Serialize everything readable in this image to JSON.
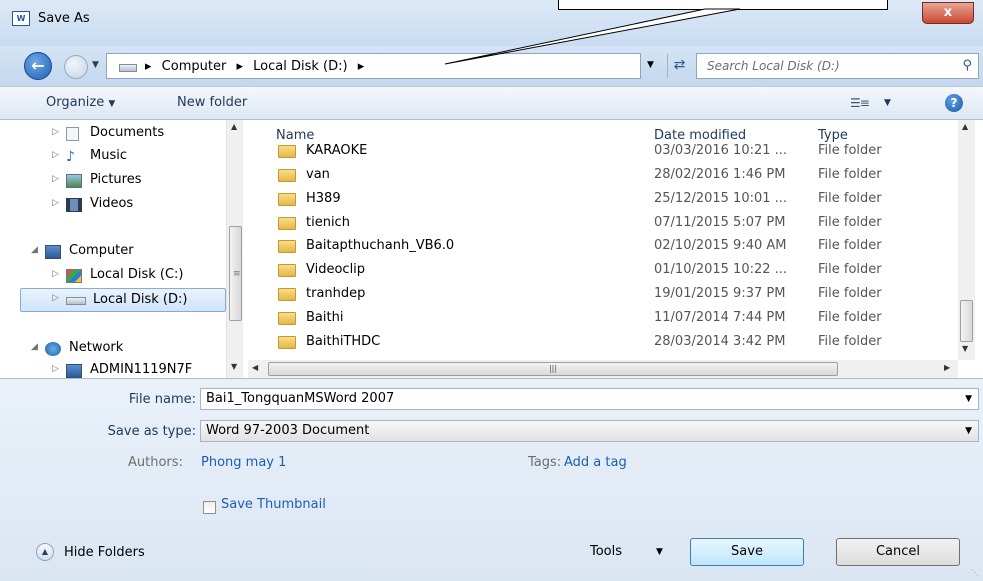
{
  "window": {
    "title": "Save As",
    "close_label": "x",
    "app_icon": "word-icon"
  },
  "address": {
    "breadcrumbs": [
      "Computer",
      "Local Disk (D:)"
    ],
    "search_placeholder": "Search Local Disk (D:)"
  },
  "toolbar": {
    "organize_label": "Organize",
    "new_folder_label": "New folder"
  },
  "nav": {
    "items": [
      {
        "label": "Documents",
        "icon": "documents-icon"
      },
      {
        "label": "Music",
        "icon": "music-icon"
      },
      {
        "label": "Pictures",
        "icon": "pictures-icon"
      },
      {
        "label": "Videos",
        "icon": "videos-icon"
      },
      {
        "label": "Computer",
        "icon": "computer-icon"
      },
      {
        "label": "Local Disk (C:)",
        "icon": "drive-c-icon"
      },
      {
        "label": "Local Disk (D:)",
        "icon": "drive-d-icon",
        "selected": true
      },
      {
        "label": "Network",
        "icon": "network-icon"
      },
      {
        "label": "ADMIN1119N7F",
        "icon": "network-computer-icon"
      }
    ]
  },
  "files": {
    "columns": {
      "name": "Name",
      "date": "Date modified",
      "type": "Type"
    },
    "rows": [
      {
        "name": "KARAOKE",
        "date": "03/03/2016 10:21 ...",
        "type": "File folder"
      },
      {
        "name": "van",
        "date": "28/02/2016 1:46 PM",
        "type": "File folder"
      },
      {
        "name": "H389",
        "date": "25/12/2015 10:01 ...",
        "type": "File folder"
      },
      {
        "name": "tienich",
        "date": "07/11/2015 5:07 PM",
        "type": "File folder"
      },
      {
        "name": "Baitapthuchanh_VB6.0",
        "date": "02/10/2015 9:40 AM",
        "type": "File folder"
      },
      {
        "name": "Videoclip",
        "date": "01/10/2015 10:22 ...",
        "type": "File folder"
      },
      {
        "name": "tranhdep",
        "date": "19/01/2015 9:37 PM",
        "type": "File folder"
      },
      {
        "name": "Baithi",
        "date": "11/07/2014 7:44 PM",
        "type": "File folder"
      },
      {
        "name": "BaithiTHDC",
        "date": "28/03/2014 3:42 PM",
        "type": "File folder"
      }
    ]
  },
  "form": {
    "file_name_label": "File name:",
    "file_name_value": "Bai1_TongquanMSWord 2007",
    "save_type_label": "Save as type:",
    "save_type_value": "Word 97-2003 Document",
    "authors_label": "Authors:",
    "authors_value": "Phong may 1",
    "tags_label": "Tags:",
    "tags_value": "Add a tag",
    "thumbnail_label": "Save Thumbnail",
    "thumbnail_checked": false
  },
  "footer": {
    "hide_folders_label": "Hide Folders",
    "tools_label": "Tools",
    "save_label": "Save",
    "cancel_label": "Cancel"
  }
}
